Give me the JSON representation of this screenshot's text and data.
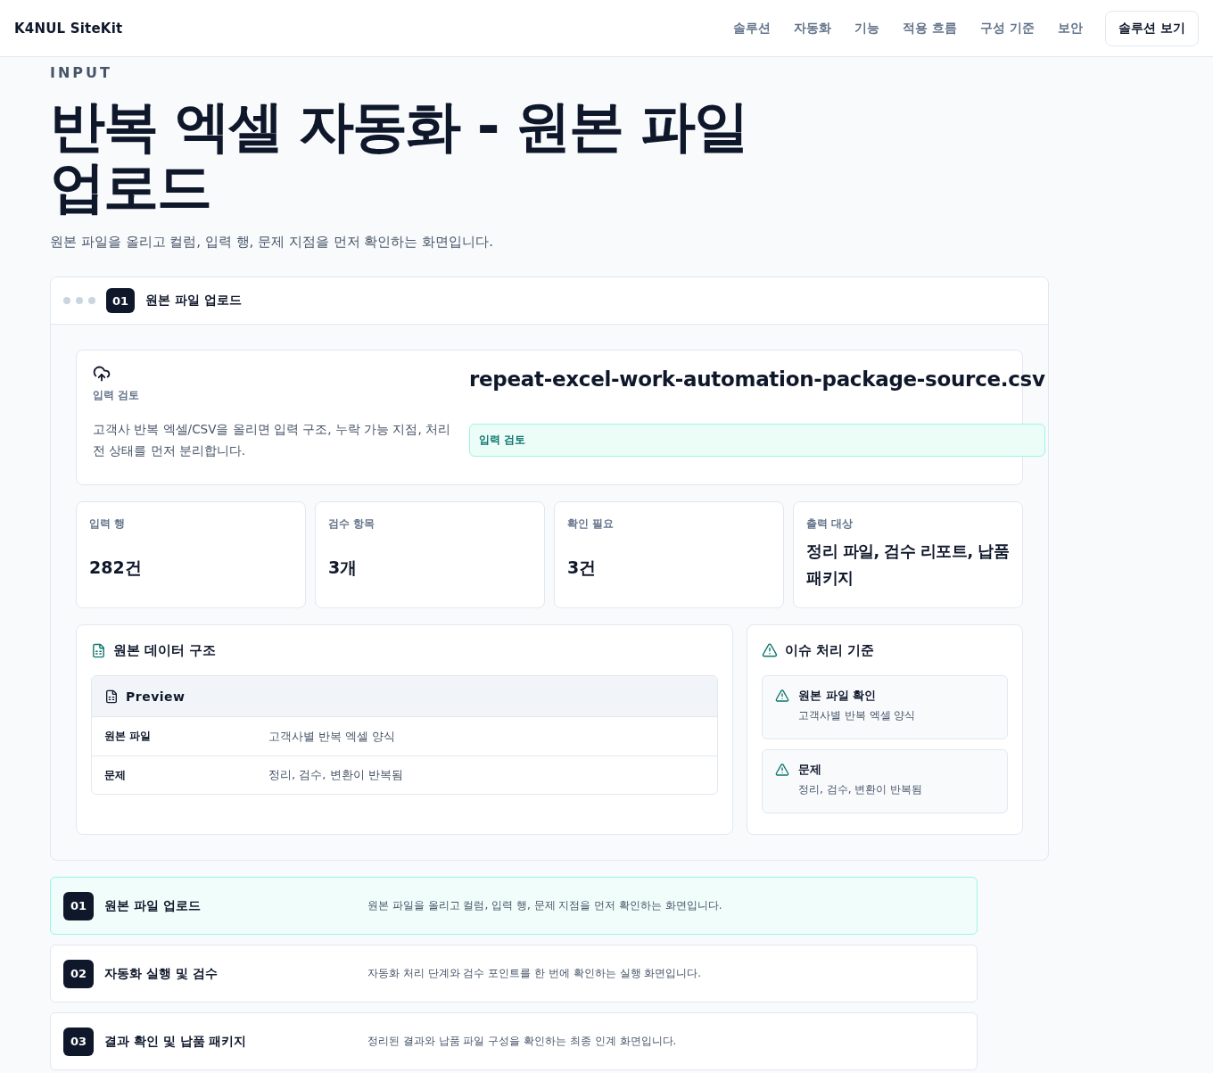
{
  "header": {
    "logo": "K4NUL SiteKit",
    "nav": [
      "솔루션",
      "자동화",
      "기능",
      "적용 흐름",
      "구성 기준",
      "보안"
    ],
    "cta": "솔루션 보기"
  },
  "hero": {
    "eyebrow": "INPUT",
    "title": "반복 엑셀 자동화 - 원본 파일 업로드",
    "subtitle": "원본 파일을 올리고 컬럼, 입력 행, 문제 지점을 먼저 확인하는 화면입니다."
  },
  "panel": {
    "step": "01",
    "title": "원본 파일 업로드",
    "upload": {
      "label": "입력 검토",
      "description": "고객사 반복 엑셀/CSV을 올리면 입력 구조, 누락 가능 지점, 처리 전 상태를 먼저 분리합니다.",
      "filename": "repeat-excel-work-automation-package-source.csv",
      "status": "입력 검토"
    },
    "stats": [
      {
        "label": "입력 행",
        "value": "282건"
      },
      {
        "label": "검수 항목",
        "value": "3개"
      },
      {
        "label": "확인 필요",
        "value": "3건"
      },
      {
        "label": "출력 대상",
        "value": "정리 파일, 검수 리포트, 납품 패키지"
      }
    ],
    "structure": {
      "title": "원본 데이터 구조",
      "preview_title": "Preview",
      "rows": [
        {
          "key": "원본 파일",
          "value": "고객사별 반복 엑셀 양식"
        },
        {
          "key": "문제",
          "value": "정리, 검수, 변환이 반복됨"
        }
      ]
    },
    "issues": {
      "title": "이슈 처리 기준",
      "items": [
        {
          "title": "원본 파일 확인",
          "description": "고객사별 반복 엑셀 양식"
        },
        {
          "title": "문제",
          "description": "정리, 검수, 변환이 반복됨"
        }
      ]
    }
  },
  "steps": [
    {
      "number": "01",
      "title": "원본 파일 업로드",
      "description": "원본 파일을 올리고 컬럼, 입력 행, 문제 지점을 먼저 확인하는 화면입니다.",
      "selected": true
    },
    {
      "number": "02",
      "title": "자동화 실행 및 검수",
      "description": "자동화 처리 단계와 검수 포인트를 한 번에 확인하는 실행 화면입니다.",
      "selected": false
    },
    {
      "number": "03",
      "title": "결과 확인 및 납품 패키지",
      "description": "정리된 결과와 납품 파일 구성을 확인하는 최종 인계 화면입니다.",
      "selected": false
    }
  ]
}
